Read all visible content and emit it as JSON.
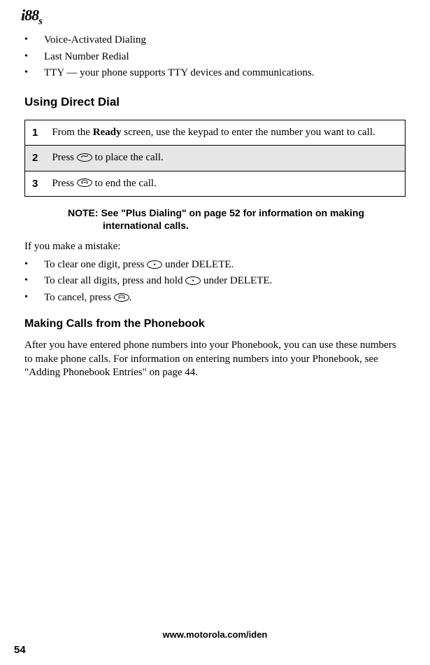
{
  "header": {
    "logo": "i88",
    "logo_suffix": "s"
  },
  "intro_bullets": [
    "Voice-Activated Dialing",
    "Last Number Redial",
    "TTY — your phone supports TTY devices and communications."
  ],
  "section1": {
    "title": "Using Direct Dial",
    "steps": [
      {
        "n": "1",
        "text_pre": "From the ",
        "bold": "Ready",
        "text_post": " screen, use the keypad to enter the number you want to call."
      },
      {
        "n": "2",
        "text_pre": "Press ",
        "icon": "call-key-icon",
        "text_post": " to place the call."
      },
      {
        "n": "3",
        "text_pre": "Press ",
        "icon": "end-key-icon",
        "text_post": " to end the call."
      }
    ],
    "note_label": "NOTE:",
    "note_text": "See \"Plus Dialing\" on page 52 for information on making international calls.",
    "mistake_intro": "If you make a mistake:",
    "mistake_bullets": [
      {
        "pre": "To clear one digit, press ",
        "icon": "dot-key-icon",
        "post": " under DELETE."
      },
      {
        "pre": "To clear all digits, press and hold ",
        "icon": "dot-key-icon",
        "post": " under DELETE."
      },
      {
        "pre": "To cancel, press ",
        "icon": "end-key-icon",
        "post": "."
      }
    ]
  },
  "section2": {
    "title": "Making Calls from the Phonebook",
    "body": "After you have entered phone numbers into your Phonebook, you can use these numbers to make phone calls. For information on entering numbers into your Phonebook, see \"Adding Phonebook Entries\" on page 44."
  },
  "footer": {
    "url": "www.motorola.com/iden",
    "page": "54"
  }
}
